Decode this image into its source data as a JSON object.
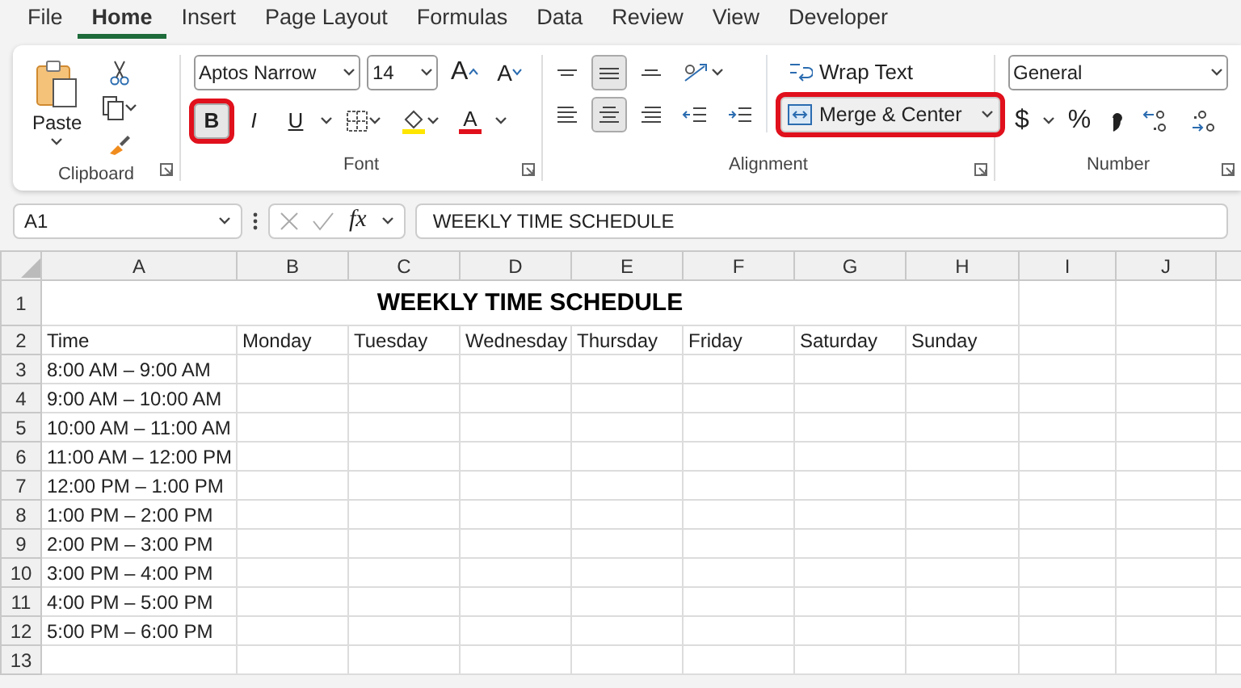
{
  "menu_tabs": [
    {
      "label": "File",
      "selected": false
    },
    {
      "label": "Home",
      "selected": true
    },
    {
      "label": "Insert",
      "selected": false
    },
    {
      "label": "Page Layout",
      "selected": false
    },
    {
      "label": "Formulas",
      "selected": false
    },
    {
      "label": "Data",
      "selected": false
    },
    {
      "label": "Review",
      "selected": false
    },
    {
      "label": "View",
      "selected": false
    },
    {
      "label": "Developer",
      "selected": false
    }
  ],
  "ribbon": {
    "clipboard": {
      "paste_label": "Paste",
      "group_label": "Clipboard"
    },
    "font": {
      "font_name": "Aptos Narrow",
      "font_size": "14",
      "grow_label": "A",
      "shrink_label": "A",
      "styles": [
        {
          "kind": "bold",
          "label": "B",
          "selected": true,
          "highlighted": true
        },
        {
          "kind": "italic",
          "label": "I",
          "selected": false,
          "highlighted": false
        },
        {
          "kind": "underline",
          "label": "U",
          "selected": false,
          "highlighted": false
        }
      ],
      "font_color_label": "A",
      "group_label": "Font"
    },
    "alignment": {
      "vertical": [
        {
          "kind": "top",
          "selected": false
        },
        {
          "kind": "middle",
          "selected": true
        },
        {
          "kind": "bottom",
          "selected": false
        }
      ],
      "horizontal": [
        {
          "kind": "left",
          "selected": false
        },
        {
          "kind": "center",
          "selected": true
        },
        {
          "kind": "right",
          "selected": false
        }
      ],
      "wrap_text": "Wrap Text",
      "merge": {
        "label": "Merge & Center",
        "highlighted": true
      },
      "group_label": "Alignment"
    },
    "number": {
      "format": "General",
      "currency": "$",
      "percent": "%",
      "group_label": "Number"
    }
  },
  "formula_bar": {
    "name_box": "A1",
    "fx": "fx",
    "content": "WEEKLY TIME SCHEDULE"
  },
  "sheet": {
    "columns": [
      "A",
      "B",
      "C",
      "D",
      "E",
      "F",
      "G",
      "H",
      "I",
      "J"
    ],
    "row_numbers": [
      "1",
      "2",
      "3",
      "4",
      "5",
      "6",
      "7",
      "8",
      "9",
      "10",
      "11",
      "12",
      "13"
    ],
    "title": "WEEKLY TIME SCHEDULE",
    "header_row": [
      "Time",
      "Monday",
      "Tuesday",
      "Wednesday",
      "Thursday",
      "Friday",
      "Saturday",
      "Sunday"
    ],
    "time_slots": [
      "8:00 AM – 9:00 AM",
      "9:00 AM – 10:00 AM",
      "10:00 AM – 11:00 AM",
      "11:00 AM – 12:00 PM",
      "12:00 PM – 1:00 PM",
      "1:00 PM – 2:00 PM",
      "2:00 PM – 3:00 PM",
      "3:00 PM – 4:00 PM",
      "4:00 PM – 5:00 PM",
      "5:00 PM – 6:00 PM"
    ]
  }
}
